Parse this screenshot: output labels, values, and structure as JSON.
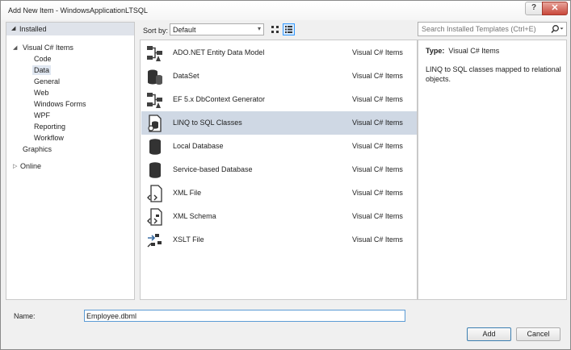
{
  "window": {
    "title": "Add New Item - WindowsApplicationLTSQL",
    "help_label": "?",
    "close_label": "✕"
  },
  "tree": {
    "installed_label": "Installed",
    "group_label": "Visual C# Items",
    "children": [
      "Code",
      "Data",
      "General",
      "Web",
      "Windows Forms",
      "WPF",
      "Reporting",
      "Workflow"
    ],
    "selected": "Data",
    "graphics_label": "Graphics",
    "online_label": "Online"
  },
  "sort": {
    "label": "Sort by:",
    "value": "Default"
  },
  "templates": [
    {
      "name": "ADO.NET Entity Data Model",
      "type": "Visual C# Items",
      "icon": "entity-model-icon"
    },
    {
      "name": "DataSet",
      "type": "Visual C# Items",
      "icon": "database-icon"
    },
    {
      "name": "EF 5.x DbContext Generator",
      "type": "Visual C# Items",
      "icon": "entity-model-icon"
    },
    {
      "name": "LINQ to SQL Classes",
      "type": "Visual C# Items",
      "icon": "linq-to-sql-icon"
    },
    {
      "name": "Local Database",
      "type": "Visual C# Items",
      "icon": "database-icon"
    },
    {
      "name": "Service-based Database",
      "type": "Visual C# Items",
      "icon": "database-icon"
    },
    {
      "name": "XML File",
      "type": "Visual C# Items",
      "icon": "xml-file-icon"
    },
    {
      "name": "XML Schema",
      "type": "Visual C# Items",
      "icon": "xml-schema-icon"
    },
    {
      "name": "XSLT File",
      "type": "Visual C# Items",
      "icon": "xslt-file-icon"
    }
  ],
  "selected_template": "LINQ to SQL Classes",
  "search": {
    "placeholder": "Search Installed Templates (Ctrl+E)"
  },
  "details": {
    "type_label": "Type:",
    "type_value": "Visual C# Items",
    "description": "LINQ to SQL classes mapped to relational objects."
  },
  "name_field": {
    "label": "Name:",
    "value": "Employee.dbml"
  },
  "buttons": {
    "add": "Add",
    "cancel": "Cancel"
  },
  "colors": {
    "selection": "#cfd8e4",
    "tree_selection": "#e0e7f1",
    "focus_border": "#5b9bd5",
    "close_red": "#c9483b"
  }
}
